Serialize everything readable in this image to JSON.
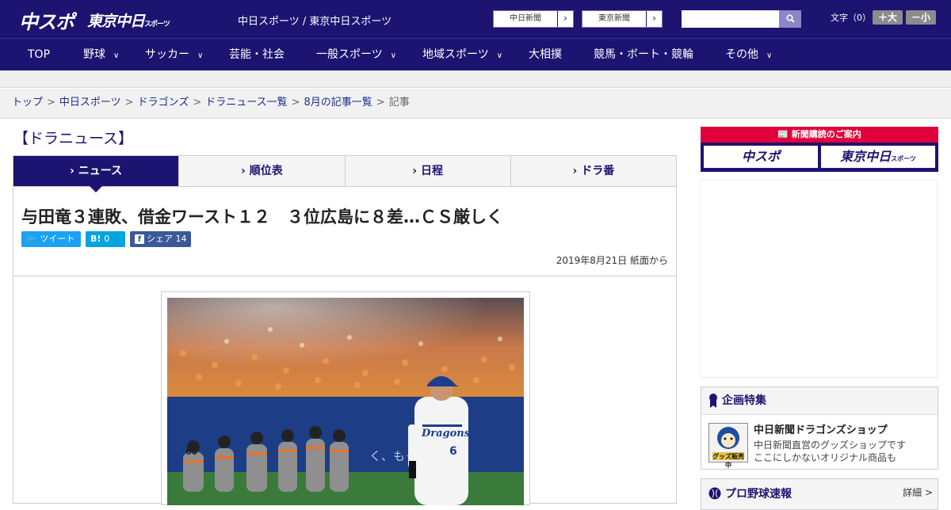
{
  "header": {
    "logo_main": "中スポ",
    "logo_tokyo": "東京中日",
    "logo_tokyo_small": "スポーツ",
    "site_name": "中日スポーツ / 東京中日スポーツ",
    "ext_chunichi": "中日新聞",
    "ext_tokyo": "東京新聞",
    "search_placeholder": "",
    "font_label": "文字（0）",
    "font_bigger": "＋大",
    "font_smaller": "－小"
  },
  "nav": [
    "TOP",
    "野球",
    "サッカー",
    "芸能・社会",
    "一般スポーツ",
    "地域スポーツ",
    "大相撲",
    "競馬・ボート・競輪",
    "その他"
  ],
  "breadcrumb": [
    "トップ",
    "中日スポーツ",
    "ドラゴンズ",
    "ドラニュース一覧",
    "8月の記事一覧",
    "記事"
  ],
  "section_title": "【ドラニュース】",
  "tabs": [
    "ニュース",
    "順位表",
    "日程",
    "ドラ番"
  ],
  "article": {
    "headline": "与田竜３連敗、借金ワースト１２　３位広島に８差…ＣＳ厳しく",
    "tweet_label": "ツイート",
    "hatena_label": "B!",
    "hatena_count": "0",
    "share_label": "シェア",
    "share_count": "14",
    "date": "2019年8月21日 紙面から"
  },
  "photo": {
    "jersey_text": "Dragons",
    "jersey_number": "6",
    "away_number": "60",
    "banner_text": "く、もっと。"
  },
  "sidebar": {
    "subscribe_title": "新聞購読のご案内",
    "sub_btn1": "中スポ",
    "sub_btn2": "東京中日",
    "sub_btn2_small": "スポーツ",
    "feature_header": "企画特集",
    "feature_title": "中日新聞ドラゴンズショップ",
    "feature_desc1": "中日新聞直営のグッズショップです",
    "feature_desc2": "ここにしかないオリジナル商品も",
    "feature_badge": "グッズ販売中",
    "live_header": "プロ野球速報",
    "live_more": "詳細 >"
  },
  "colors": {
    "brand_navy": "#1d1471",
    "accent_red": "#e0003a",
    "twitter": "#1da1f2",
    "hatena": "#00a4de",
    "facebook": "#3b5998"
  }
}
